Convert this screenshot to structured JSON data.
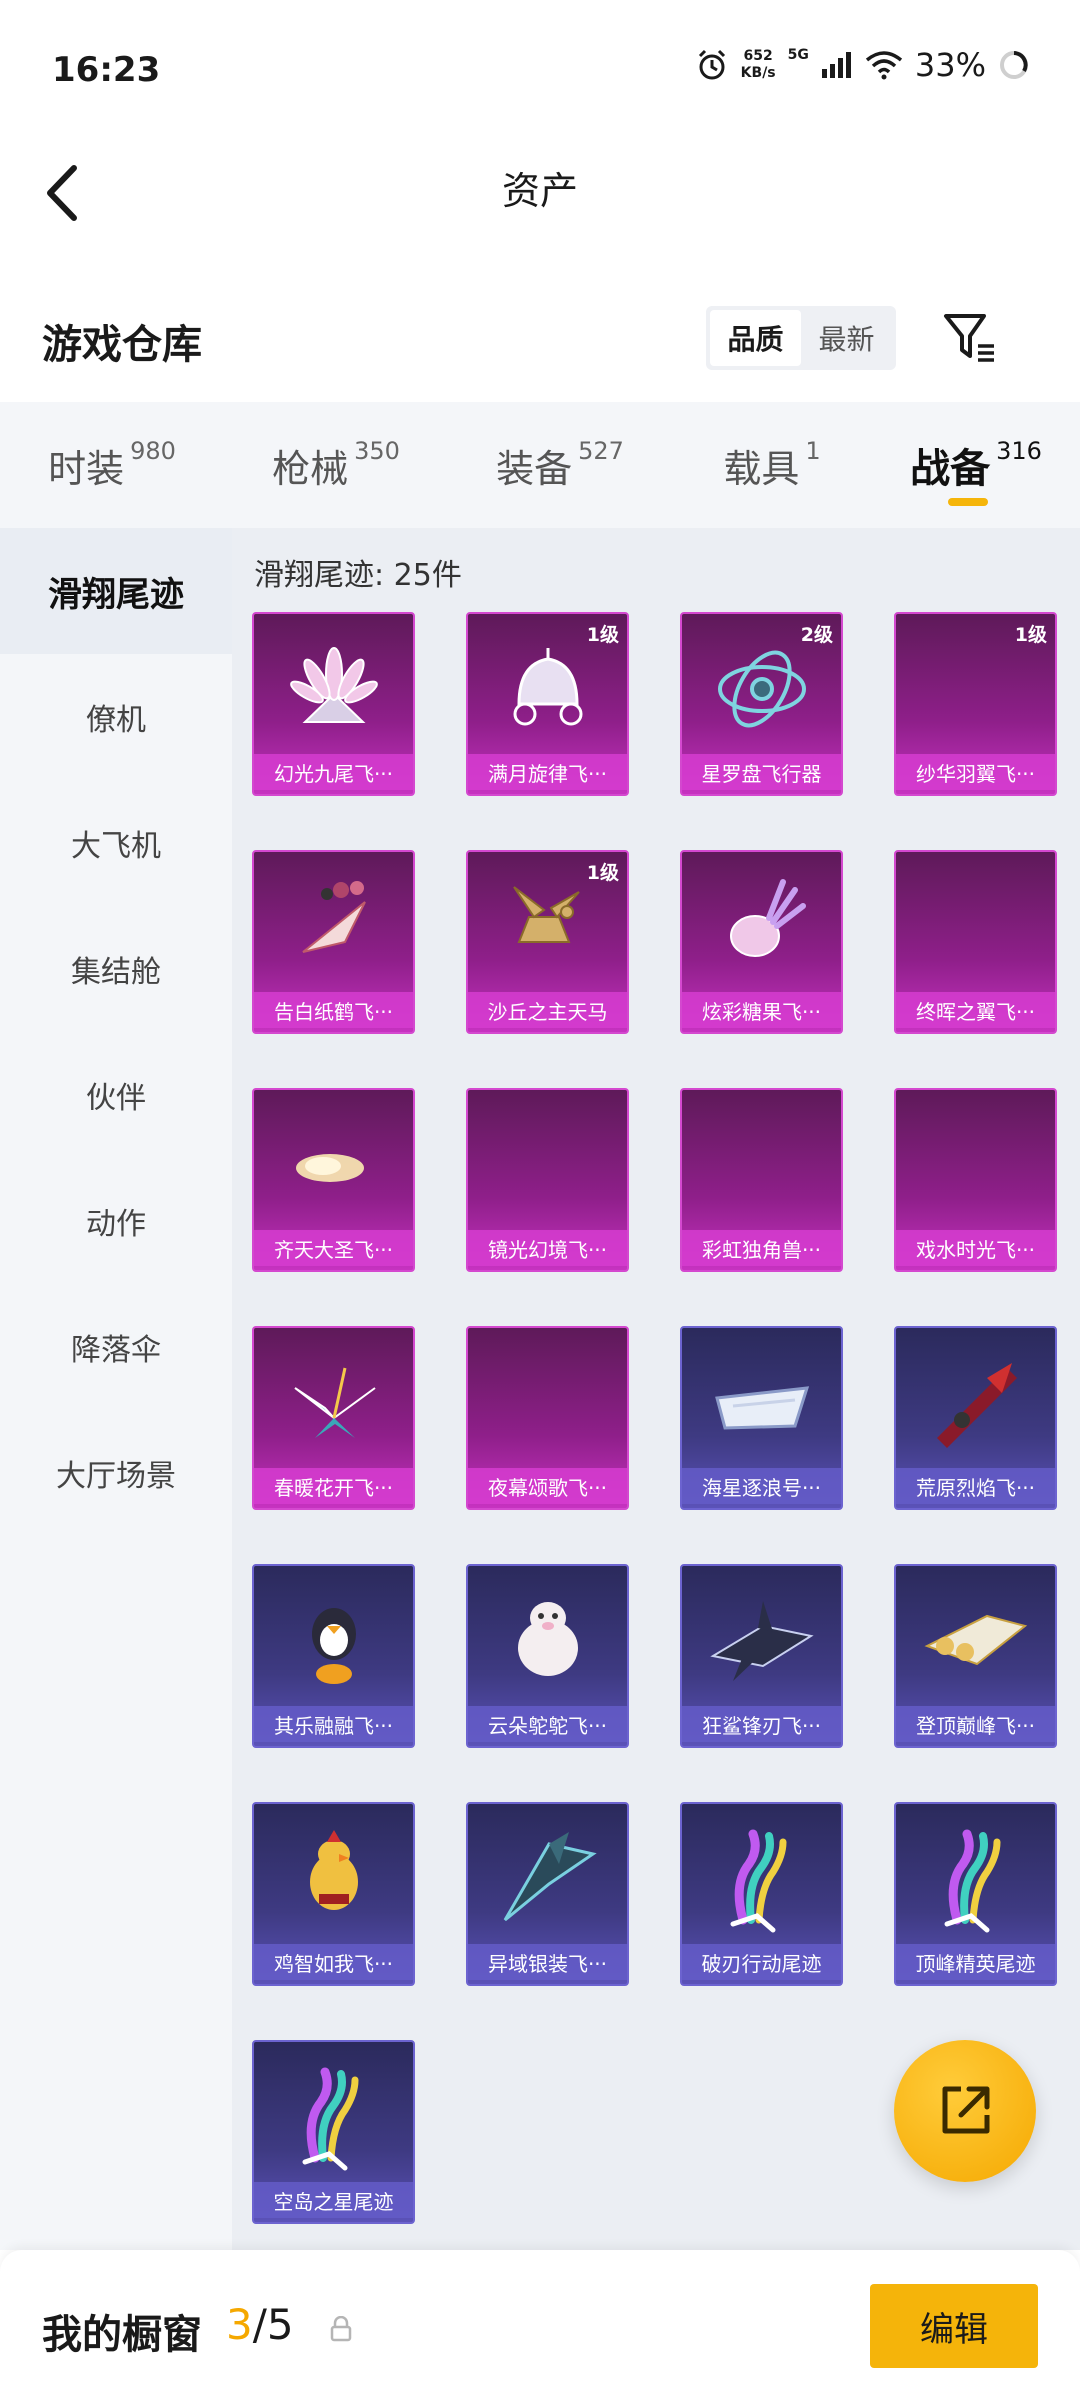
{
  "status_bar": {
    "time": "16:23",
    "net_speed": "652",
    "net_unit": "KB/s",
    "network": "5G",
    "battery": "33%"
  },
  "header": {
    "title": "资产"
  },
  "warehouse": {
    "title": "游戏仓库",
    "sort_options": [
      "品质",
      "最新"
    ],
    "active_sort": 0
  },
  "category_tabs": [
    {
      "label": "时装",
      "count": "980",
      "active": false
    },
    {
      "label": "枪械",
      "count": "350",
      "active": false
    },
    {
      "label": "装备",
      "count": "527",
      "active": false
    },
    {
      "label": "载具",
      "count": "1",
      "active": false
    },
    {
      "label": "战备",
      "count": "316",
      "active": true
    }
  ],
  "sidebar": {
    "items": [
      "滑翔尾迹",
      "僚机",
      "大飞机",
      "集结舱",
      "伙伴",
      "动作",
      "降落伞",
      "大厅场景"
    ],
    "active_index": 0
  },
  "grid": {
    "heading": "滑翔尾迹: 25件",
    "items": [
      {
        "name": "幻光九尾飞···",
        "level": "",
        "rarity": "purple",
        "icon": "nine-tail-glider-icon"
      },
      {
        "name": "满月旋律飞···",
        "level": "1级",
        "rarity": "purple",
        "icon": "carriage-glider-icon"
      },
      {
        "name": "星罗盘飞行器",
        "level": "2级",
        "rarity": "purple",
        "icon": "astrolabe-glider-icon"
      },
      {
        "name": "纱华羽翼飞···",
        "level": "1级",
        "rarity": "purple",
        "icon": ""
      },
      {
        "name": "告白纸鹤飞···",
        "level": "",
        "rarity": "purple",
        "icon": "paper-crane-glider-icon"
      },
      {
        "name": "沙丘之主天马",
        "level": "1级",
        "rarity": "purple",
        "icon": "pegasus-glider-icon"
      },
      {
        "name": "炫彩糖果飞···",
        "level": "",
        "rarity": "purple",
        "icon": "candy-glider-icon"
      },
      {
        "name": "终晖之翼飞···",
        "level": "",
        "rarity": "purple",
        "icon": ""
      },
      {
        "name": "齐天大圣飞···",
        "level": "",
        "rarity": "purple",
        "icon": "cloud-glider-icon"
      },
      {
        "name": "镜光幻境飞···",
        "level": "",
        "rarity": "purple",
        "icon": ""
      },
      {
        "name": "彩虹独角兽···",
        "level": "",
        "rarity": "purple",
        "icon": ""
      },
      {
        "name": "戏水时光飞···",
        "level": "",
        "rarity": "purple",
        "icon": ""
      },
      {
        "name": "春暖花开飞···",
        "level": "",
        "rarity": "purple",
        "icon": "butterfly-glider-icon"
      },
      {
        "name": "夜幕颂歌飞···",
        "level": "",
        "rarity": "purple",
        "icon": ""
      },
      {
        "name": "海星逐浪号···",
        "level": "",
        "rarity": "blue",
        "icon": "boat-glider-icon"
      },
      {
        "name": "荒原烈焰飞···",
        "level": "",
        "rarity": "blue",
        "icon": "flame-glider-icon"
      },
      {
        "name": "其乐融融飞···",
        "level": "",
        "rarity": "blue",
        "icon": "penguin-glider-icon"
      },
      {
        "name": "云朵鸵鸵飞···",
        "level": "",
        "rarity": "blue",
        "icon": "alpaca-glider-icon"
      },
      {
        "name": "狂鲨锋刃飞···",
        "level": "",
        "rarity": "blue",
        "icon": "shark-glider-icon"
      },
      {
        "name": "登顶巅峰飞···",
        "level": "",
        "rarity": "blue",
        "icon": "jet-glider-icon"
      },
      {
        "name": "鸡智如我飞···",
        "level": "",
        "rarity": "blue",
        "icon": "chicken-glider-icon"
      },
      {
        "name": "异域银装飞···",
        "level": "",
        "rarity": "blue",
        "icon": "wing-glider-icon"
      },
      {
        "name": "破刃行动尾迹",
        "level": "",
        "rarity": "blue",
        "icon": "smoke-trail-icon"
      },
      {
        "name": "顶峰精英尾迹",
        "level": "",
        "rarity": "blue",
        "icon": "smoke-trail-icon"
      },
      {
        "name": "空岛之星尾迹",
        "level": "",
        "rarity": "blue",
        "icon": "smoke-trail-icon"
      }
    ]
  },
  "bottom_bar": {
    "label": "我的橱窗",
    "current": "3",
    "total": "/5",
    "edit_label": "编辑"
  },
  "colors": {
    "accent": "#f5b50a",
    "purple_card": "#8f1f8a",
    "blue_card": "#3e3a82"
  }
}
